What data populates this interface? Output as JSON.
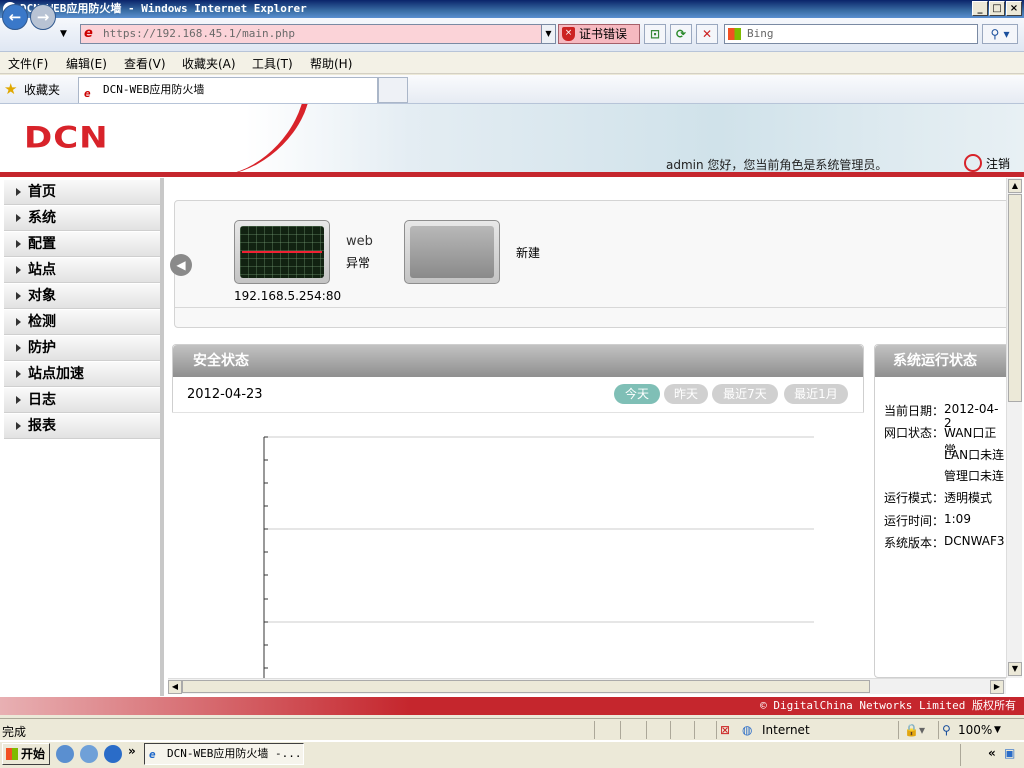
{
  "browser": {
    "window_title": "DCN-WEB应用防火墙 - Windows Internet Explorer",
    "address": "https://192.168.45.1/main.php",
    "cert_error": "证书错误",
    "search_placeholder": "Bing",
    "menu": [
      "文件(F)",
      "编辑(E)",
      "查看(V)",
      "收藏夹(A)",
      "工具(T)",
      "帮助(H)"
    ],
    "favorites_label": "收藏夹",
    "tab_title": "DCN-WEB应用防火墙",
    "status_text": "完成",
    "zone": "Internet",
    "zoom": "100%"
  },
  "header": {
    "logo": "DCN",
    "welcome": "admin 您好，您当前角色是系统管理员。",
    "logout": "注销"
  },
  "sidebar": {
    "items": [
      {
        "label": "首页"
      },
      {
        "label": "系统"
      },
      {
        "label": "配置"
      },
      {
        "label": "站点"
      },
      {
        "label": "对象"
      },
      {
        "label": "检测"
      },
      {
        "label": "防护"
      },
      {
        "label": "站点加速"
      },
      {
        "label": "日志"
      },
      {
        "label": "报表"
      }
    ]
  },
  "devices": [
    {
      "name": "web",
      "status": "异常",
      "address": "192.168.5.254:80"
    },
    {
      "name": "新建"
    }
  ],
  "security": {
    "title": "安全状态",
    "date": "2012-04-23",
    "filters": [
      "今天",
      "昨天",
      "最近7天",
      "最近1月"
    ],
    "active_filter": "今天"
  },
  "system": {
    "title": "系统运行状态",
    "rows": [
      {
        "label": "当前日期：",
        "value": "2012-04-2"
      },
      {
        "label": "网口状态：",
        "value": "WAN口正常"
      },
      {
        "label": "",
        "value": "LAN口未连"
      },
      {
        "label": "",
        "value": "管理口未连"
      },
      {
        "label": "运行模式：",
        "value": "透明模式"
      },
      {
        "label": "运行时间：",
        "value": "1:09"
      },
      {
        "label": "系统版本：",
        "value": "DCNWAF3"
      }
    ]
  },
  "footer": {
    "copyright": "© DigitalChina Networks Limited 版权所有"
  },
  "taskbar": {
    "start": "开始",
    "window": "DCN-WEB应用防火墙 -..."
  },
  "colors": {
    "brand_red": "#c5262d",
    "active_pill": "#7fbfb6"
  }
}
